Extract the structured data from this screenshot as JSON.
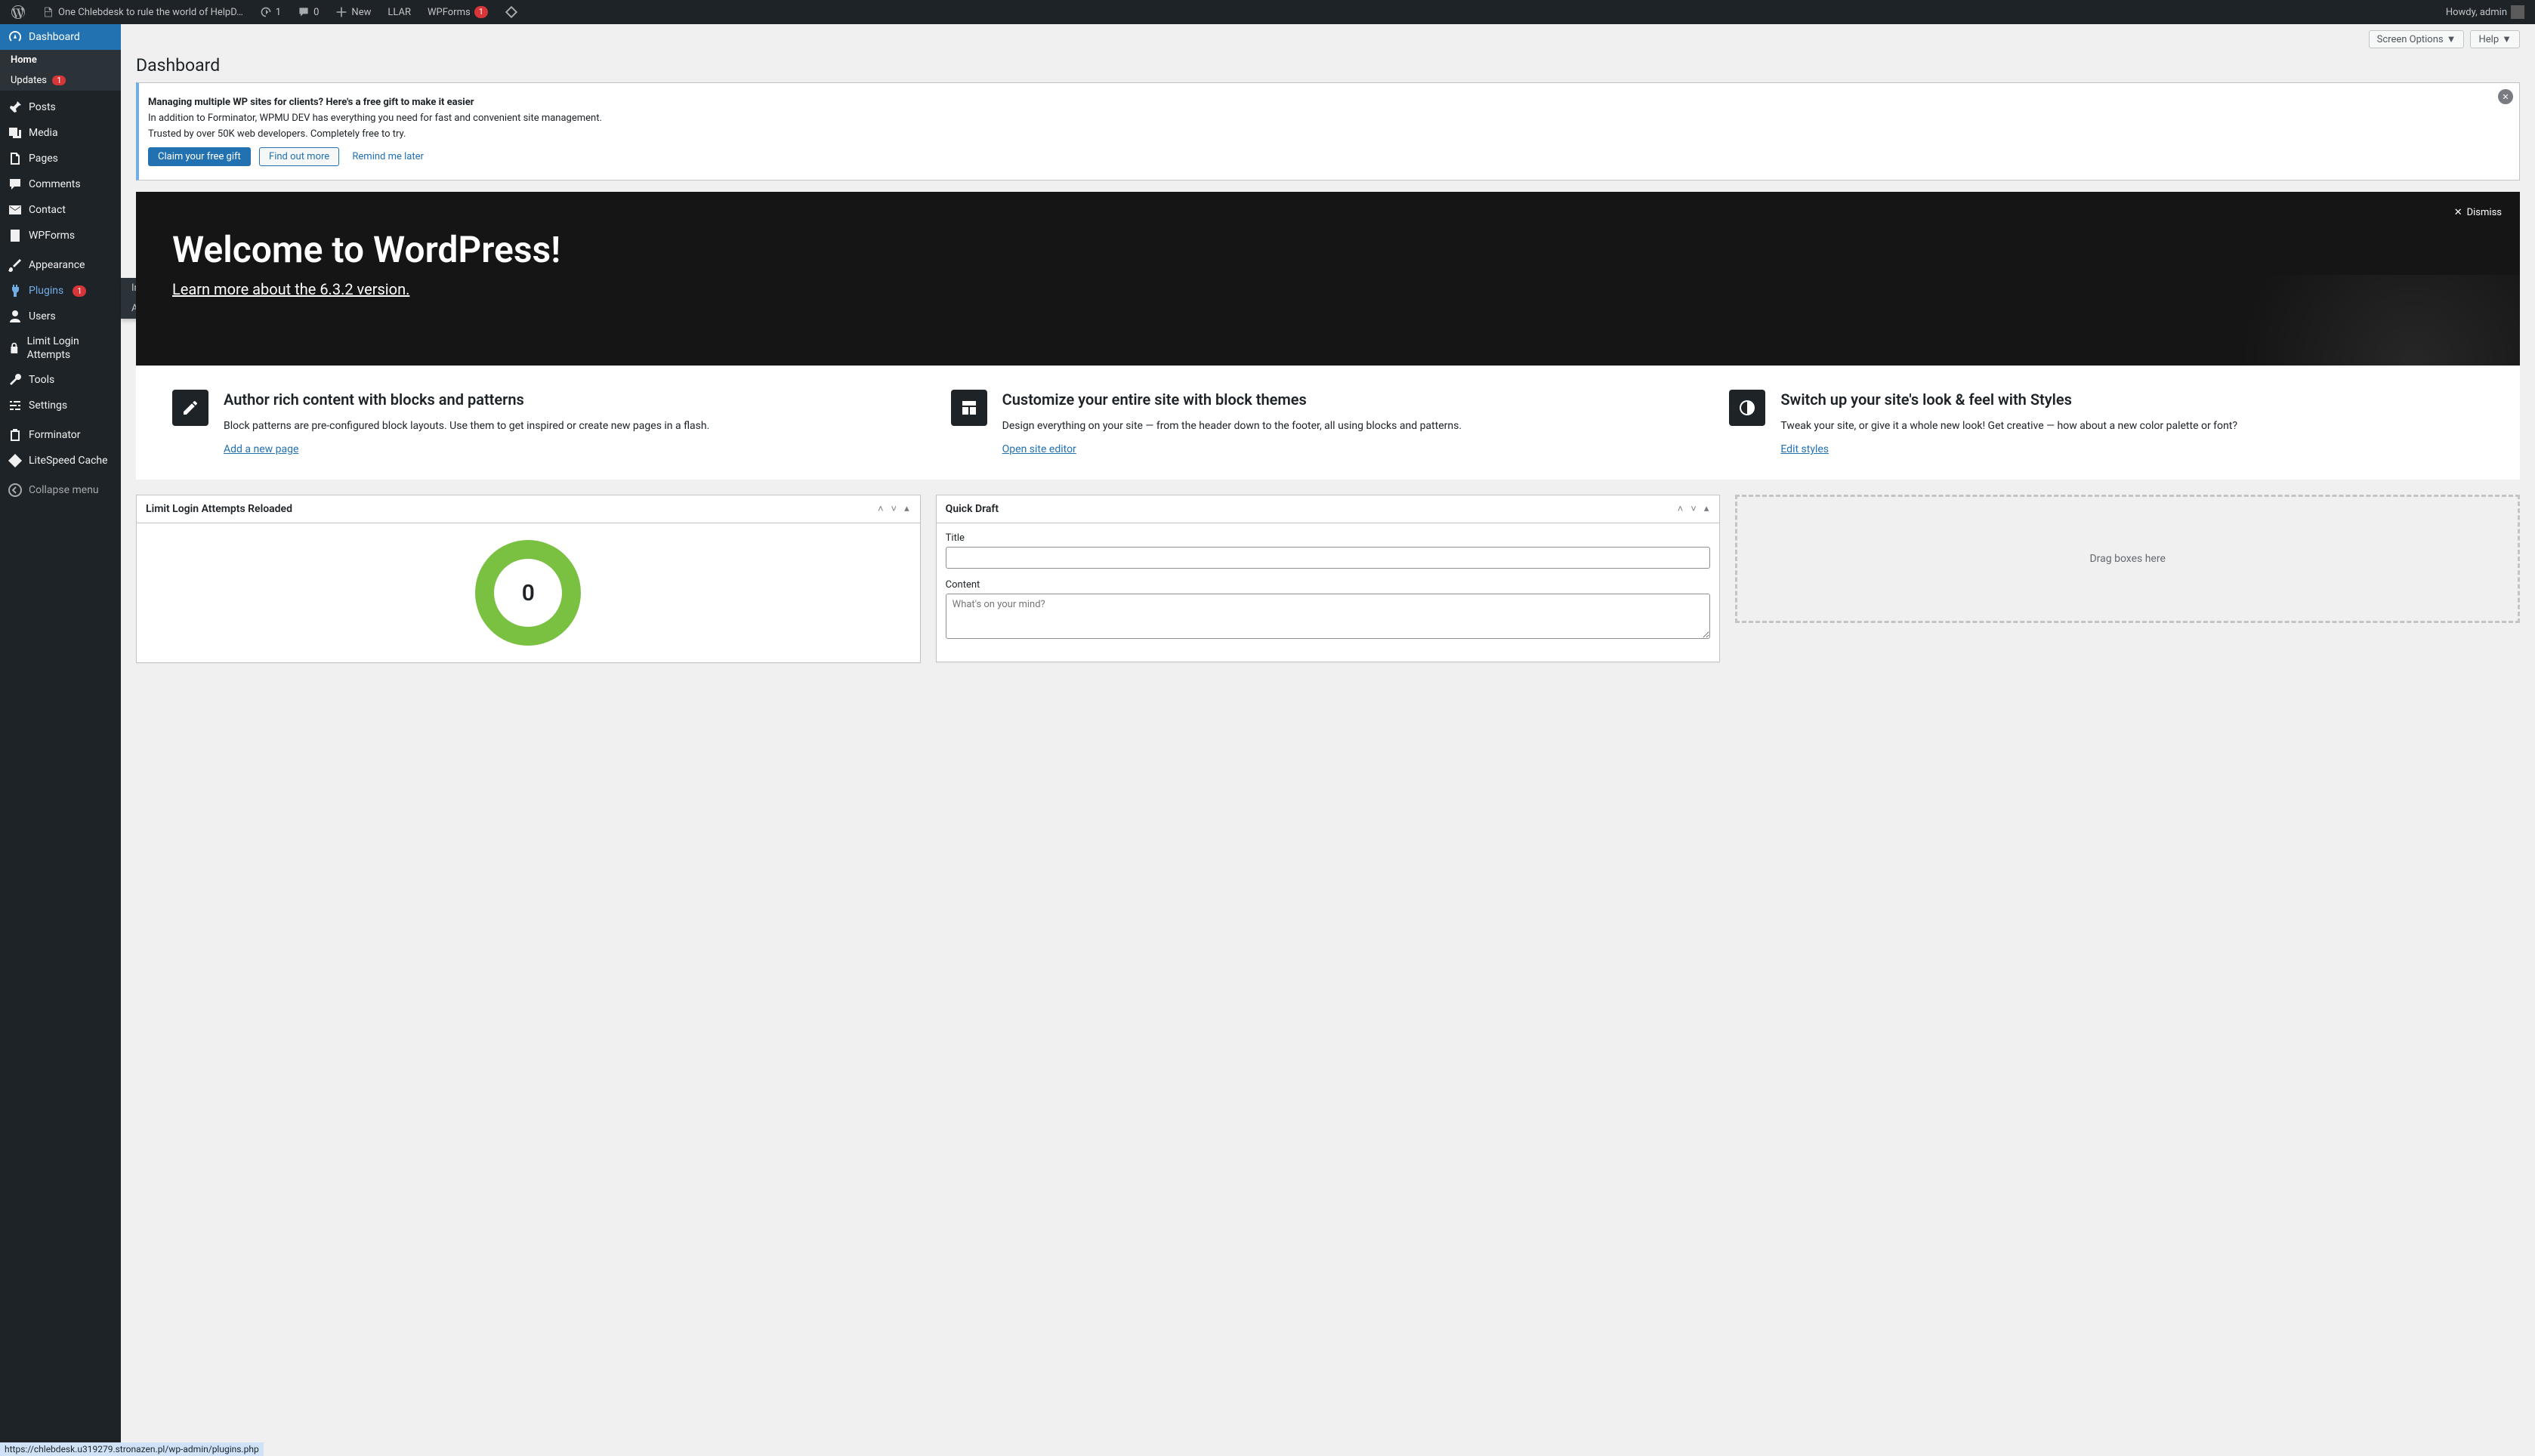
{
  "adminbar": {
    "site_title": "One Chlebdesk to rule the world of HelpD…",
    "updates": "1",
    "comments": "0",
    "new": "New",
    "llar": "LLAR",
    "wpforms": "WPForms",
    "wpforms_count": "1",
    "howdy": "Howdy, admin"
  },
  "sidebar": {
    "dashboard": "Dashboard",
    "home": "Home",
    "updates": "Updates",
    "updates_count": "1",
    "posts": "Posts",
    "media": "Media",
    "pages": "Pages",
    "comments": "Comments",
    "contact": "Contact",
    "wpforms": "WPForms",
    "appearance": "Appearance",
    "plugins": "Plugins",
    "plugins_count": "1",
    "users": "Users",
    "limit_login": "Limit Login Attempts",
    "tools": "Tools",
    "settings": "Settings",
    "forminator": "Forminator",
    "litespeed": "LiteSpeed Cache",
    "collapse": "Collapse menu"
  },
  "flyout": {
    "installed": "Installed Plugins",
    "add_new": "Add New"
  },
  "top_actions": {
    "screen_options": "Screen Options",
    "help": "Help"
  },
  "page_title": "Dashboard",
  "notice": {
    "heading": "Managing multiple WP sites for clients? Here's a free gift to make it easier",
    "line1": "In addition to Forminator, WPMU DEV has everything you need for fast and convenient site management.",
    "line2": "Trusted by over 50K web developers. Completely free to try.",
    "btn1": "Claim your free gift",
    "btn2": "Find out more",
    "btn3": "Remind me later"
  },
  "welcome": {
    "title": "Welcome to WordPress!",
    "subtitle": "Learn more about the 6.3.2 version.",
    "dismiss": "Dismiss",
    "cols": [
      {
        "title": "Author rich content with blocks and patterns",
        "text": "Block patterns are pre-configured block layouts. Use them to get inspired or create new pages in a flash.",
        "link": "Add a new page"
      },
      {
        "title": "Customize your entire site with block themes",
        "text": "Design everything on your site — from the header down to the footer, all using blocks and patterns.",
        "link": "Open site editor"
      },
      {
        "title": "Switch up your site's look & feel with Styles",
        "text": "Tweak your site, or give it a whole new look! Get creative — how about a new color palette or font?",
        "link": "Edit styles"
      }
    ]
  },
  "widgets": {
    "llar_title": "Limit Login Attempts Reloaded",
    "llar_value": "0",
    "quick_draft": "Quick Draft",
    "title_label": "Title",
    "content_label": "Content",
    "content_placeholder": "What's on your mind?",
    "drag_here": "Drag boxes here"
  },
  "status_url": "https://chlebdesk.u319279.stronazen.pl/wp-admin/plugins.php"
}
